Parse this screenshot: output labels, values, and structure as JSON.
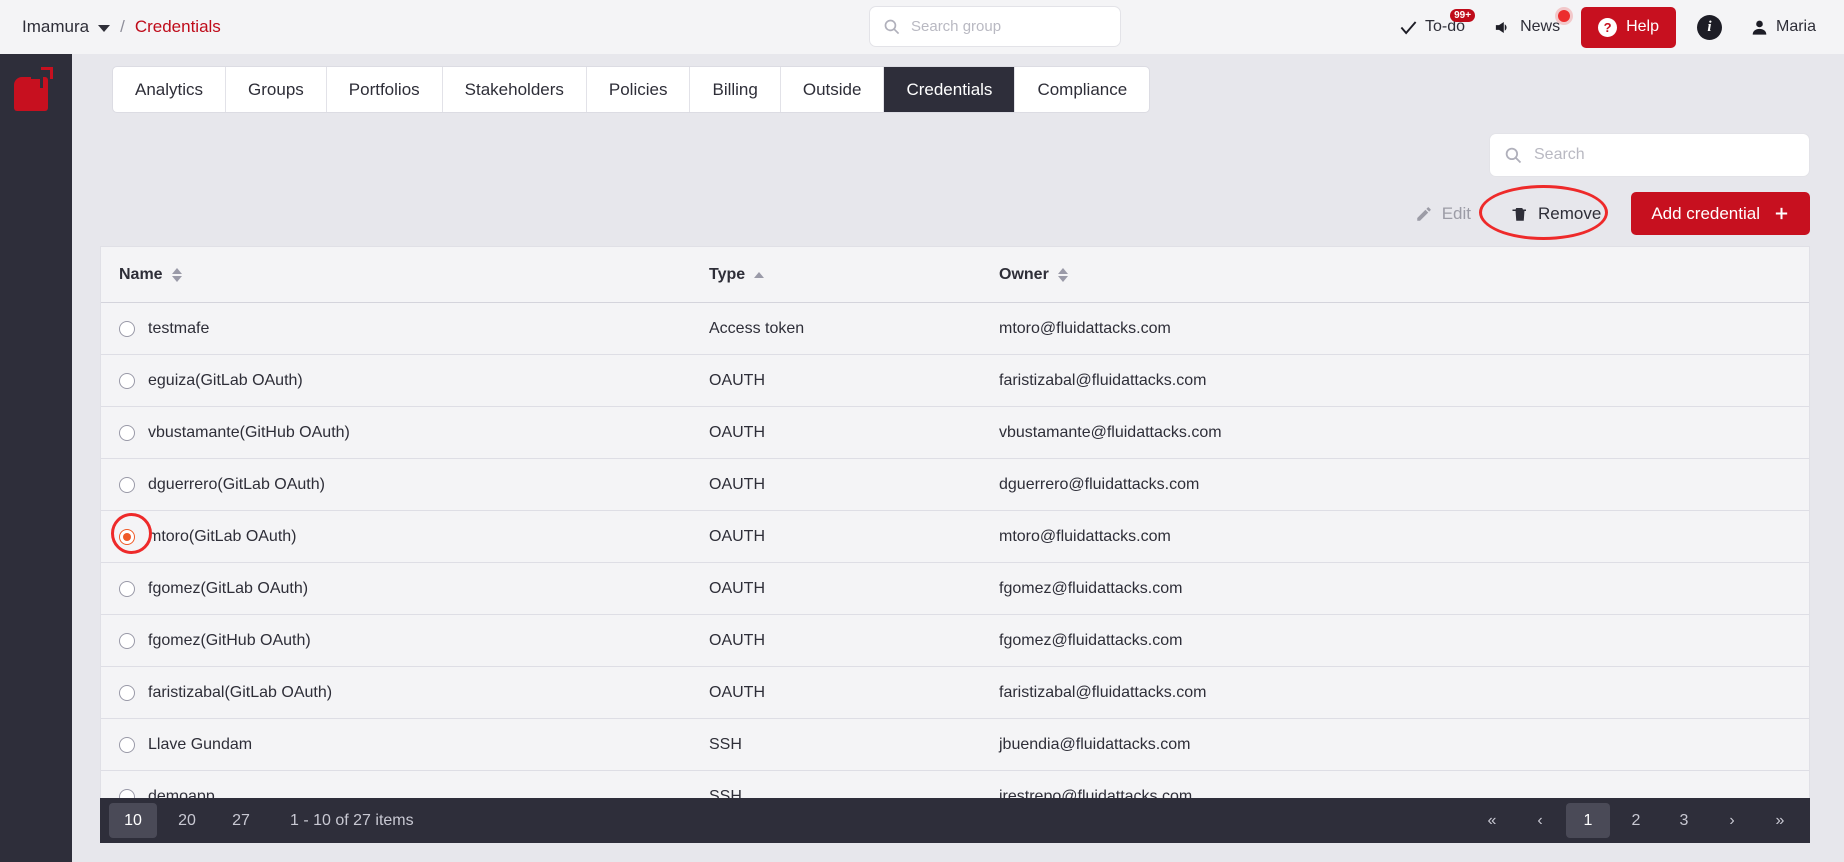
{
  "topbar": {
    "org": "Imamura",
    "separator": "/",
    "current": "Credentials",
    "search_group": {
      "placeholder": "Search group",
      "value": ""
    },
    "nav": {
      "todo_label": "To-do",
      "todo_badge": "99+",
      "news_label": "News",
      "help_label": "Help",
      "user_label": "Maria"
    }
  },
  "tabs": [
    {
      "label": "Analytics",
      "active": false
    },
    {
      "label": "Groups",
      "active": false
    },
    {
      "label": "Portfolios",
      "active": false
    },
    {
      "label": "Stakeholders",
      "active": false
    },
    {
      "label": "Policies",
      "active": false
    },
    {
      "label": "Billing",
      "active": false
    },
    {
      "label": "Outside",
      "active": false
    },
    {
      "label": "Credentials",
      "active": true
    },
    {
      "label": "Compliance",
      "active": false
    }
  ],
  "toolbar": {
    "search": {
      "placeholder": "Search",
      "value": ""
    },
    "edit_label": "Edit",
    "remove_label": "Remove",
    "add_label": "Add credential"
  },
  "table": {
    "columns": [
      {
        "key": "name",
        "label": "Name",
        "sort": "both"
      },
      {
        "key": "type",
        "label": "Type",
        "sort": "asc"
      },
      {
        "key": "owner",
        "label": "Owner",
        "sort": "both"
      }
    ],
    "rows": [
      {
        "selected": false,
        "name": "testmafe",
        "type": "Access token",
        "owner": "mtoro@fluidattacks.com"
      },
      {
        "selected": false,
        "name": "eguiza(GitLab OAuth)",
        "type": "OAUTH",
        "owner": "faristizabal@fluidattacks.com"
      },
      {
        "selected": false,
        "name": "vbustamante(GitHub OAuth)",
        "type": "OAUTH",
        "owner": "vbustamante@fluidattacks.com"
      },
      {
        "selected": false,
        "name": "dguerrero(GitLab OAuth)",
        "type": "OAUTH",
        "owner": "dguerrero@fluidattacks.com"
      },
      {
        "selected": true,
        "name": "mtoro(GitLab OAuth)",
        "type": "OAUTH",
        "owner": "mtoro@fluidattacks.com"
      },
      {
        "selected": false,
        "name": "fgomez(GitLab OAuth)",
        "type": "OAUTH",
        "owner": "fgomez@fluidattacks.com"
      },
      {
        "selected": false,
        "name": "fgomez(GitHub OAuth)",
        "type": "OAUTH",
        "owner": "fgomez@fluidattacks.com"
      },
      {
        "selected": false,
        "name": "faristizabal(GitLab OAuth)",
        "type": "OAUTH",
        "owner": "faristizabal@fluidattacks.com"
      },
      {
        "selected": false,
        "name": "Llave Gundam",
        "type": "SSH",
        "owner": "jbuendia@fluidattacks.com"
      },
      {
        "selected": false,
        "name": "demoapp",
        "type": "SSH",
        "owner": "jrestrepo@fluidattacks.com"
      }
    ]
  },
  "pagination": {
    "page_sizes": [
      "10",
      "20",
      "27"
    ],
    "active_size": "10",
    "info": "1 - 10 of 27 items",
    "first_label": "«",
    "prev_label": "‹",
    "pages": [
      "1",
      "2",
      "3"
    ],
    "active_page": "1",
    "next_label": "›",
    "last_label": "»"
  },
  "colors": {
    "accent": "#c7101f",
    "highlight": "#ee2a2a",
    "selected_radio": "#f05a28",
    "dark": "#2e2e3a"
  }
}
